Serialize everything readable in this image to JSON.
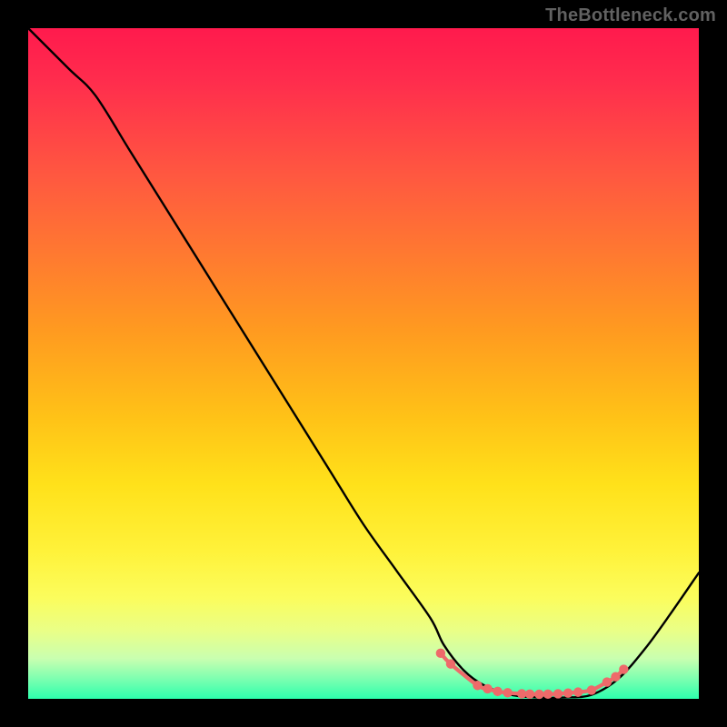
{
  "attribution": "TheBottleneck.com",
  "chart_data": {
    "type": "line",
    "title": "",
    "xlabel": "",
    "ylabel": "",
    "xlim": [
      0,
      100
    ],
    "ylim": [
      0,
      100
    ],
    "grid": false,
    "series": [
      {
        "name": "main-curve",
        "color": "#000000",
        "x": [
          0,
          6,
          10,
          15,
          20,
          25,
          30,
          35,
          40,
          45,
          50,
          55,
          60,
          62,
          65,
          68,
          72,
          76,
          80,
          84,
          88,
          92,
          96,
          100
        ],
        "y": [
          100,
          94,
          90,
          82,
          74,
          66,
          58,
          50,
          42,
          34,
          26,
          19,
          12,
          8,
          4.2,
          2.0,
          0.6,
          0.2,
          0.2,
          0.6,
          3.0,
          7.5,
          13.0,
          18.8
        ]
      },
      {
        "name": "dot-band",
        "type": "scatter",
        "color": "#ee6a6a",
        "x": [
          61.5,
          63.0,
          67.0,
          68.5,
          70.0,
          71.5,
          73.6,
          74.8,
          76.2,
          77.5,
          79.0,
          80.5,
          82.0,
          84.0,
          86.3,
          87.6,
          88.8
        ],
        "y": [
          6.8,
          5.2,
          2.0,
          1.5,
          1.1,
          0.9,
          0.75,
          0.7,
          0.68,
          0.7,
          0.75,
          0.85,
          1.0,
          1.3,
          2.5,
          3.3,
          4.4
        ]
      },
      {
        "name": "dot-connector",
        "type": "line",
        "color": "#ee6a6a",
        "x": [
          61.5,
          63.0,
          67.0,
          68.5,
          70.0,
          71.5,
          73.6,
          74.8,
          76.2,
          77.5,
          79.0,
          80.5,
          82.0,
          84.0,
          86.3,
          87.6,
          88.8
        ],
        "y": [
          6.8,
          5.2,
          2.0,
          1.5,
          1.1,
          0.9,
          0.75,
          0.7,
          0.68,
          0.7,
          0.75,
          0.85,
          1.0,
          1.3,
          2.5,
          3.3,
          4.4
        ]
      }
    ]
  },
  "colors": {
    "curve": "#000000",
    "dots": "#ee6a6a"
  }
}
